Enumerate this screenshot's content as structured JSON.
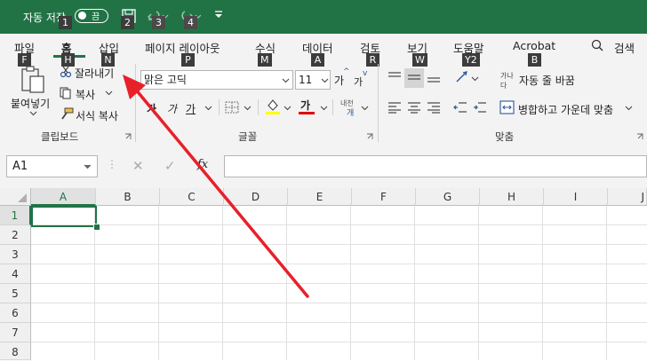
{
  "titlebar": {
    "autosave_label": "자동 저장",
    "autosave_state": "끔",
    "undo_icon": "undo-icon",
    "redo_icon": "redo-icon",
    "customize_icon": "customize-toolbar-icon"
  },
  "keytips": {
    "autosave": "1",
    "save": "2",
    "undo": "3",
    "redo": "4",
    "file": "F",
    "home": "H",
    "insert": "N",
    "page_layout": "P",
    "formulas": "M",
    "data": "A",
    "review": "R",
    "view": "W",
    "help": "Y2",
    "acrobat": "B"
  },
  "tabs": {
    "file": "파일",
    "home": "홈",
    "insert": "삽입",
    "page_layout": "페이지 레이아웃",
    "formulas": "수식",
    "data": "데이터",
    "review": "검토",
    "view": "보기",
    "help": "도움말",
    "acrobat": "Acrobat",
    "search": "검색"
  },
  "clipboard": {
    "paste": "붙여넣기",
    "cut": "잘라내기",
    "copy": "복사",
    "format_painter": "서식 복사",
    "group": "클립보드"
  },
  "font": {
    "name": "맑은 고딕",
    "size": "11",
    "grow": "가",
    "shrink": "가",
    "bold": "가",
    "italic": "가",
    "underline": "가",
    "font_color_glyph": "가",
    "phonetic": "내천",
    "group": "글꼴"
  },
  "alignment": {
    "wrap_text": "자동 줄 바꿈",
    "merge_center": "병합하고 가운데 맞춤",
    "group": "맞춤"
  },
  "formula_bar": {
    "name_box": "A1",
    "fx": "fx",
    "formula": ""
  },
  "grid": {
    "columns": [
      "A",
      "B",
      "C",
      "D",
      "E",
      "F",
      "G",
      "H",
      "I",
      "J"
    ],
    "rows": [
      "1",
      "2",
      "3",
      "4",
      "5",
      "6",
      "7",
      "8"
    ],
    "active_cell": "A1"
  },
  "colors": {
    "accent": "#217346",
    "arrow": "#e8202a",
    "font_color": "#c00000",
    "highlight": "#ffff00"
  }
}
